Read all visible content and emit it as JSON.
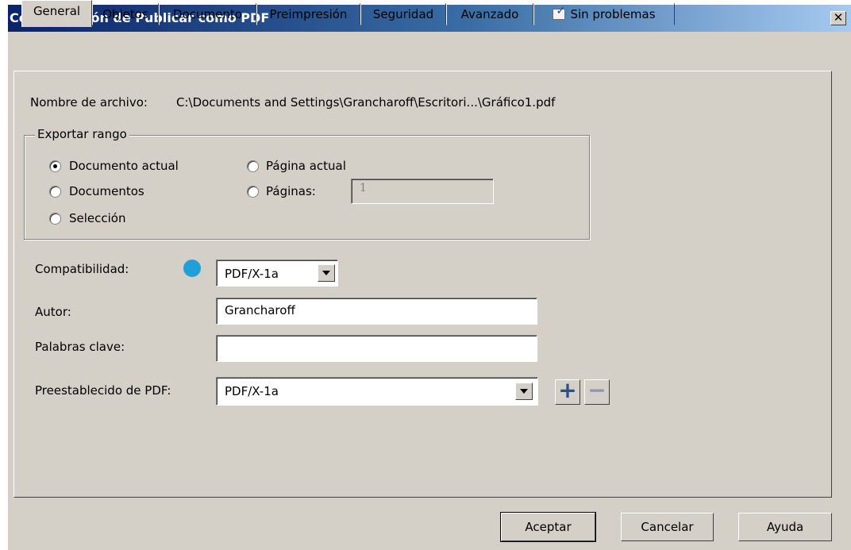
{
  "window": {
    "title": "Configuración de Publicar como PDF",
    "close_glyph": "✕"
  },
  "tabs": [
    {
      "label": "General",
      "active": true
    },
    {
      "label": "Objetos"
    },
    {
      "label": "Documento"
    },
    {
      "label": "Preimpresión"
    },
    {
      "label": "Seguridad"
    },
    {
      "label": "Avanzado"
    },
    {
      "label": "Sin problemas",
      "icon": "checklist-icon"
    }
  ],
  "general": {
    "filename_label": "Nombre de archivo:",
    "filename_value": "C:\\Documents and Settings\\Grancharoff\\Escritori...\\Gráfico1.pdf",
    "export_range": {
      "title": "Exportar rango",
      "current_document": "Documento actual",
      "documents": "Documentos",
      "selection": "Selección",
      "current_page": "Página actual",
      "pages": "Páginas:",
      "pages_value": "1",
      "selected": "current_document"
    },
    "compatibility_label": "Compatibilidad:",
    "compatibility_value": "PDF/X-1a",
    "author_label": "Autor:",
    "author_value": "Grancharoff",
    "keywords_label": "Palabras clave:",
    "keywords_value": "",
    "preset_label": "Preestablecido de PDF:",
    "preset_value": "PDF/X-1a",
    "add_preset_glyph": "+",
    "remove_preset_glyph": "−"
  },
  "buttons": {
    "ok": "Aceptar",
    "cancel": "Cancelar",
    "help": "Ayuda"
  },
  "colors": {
    "accent_dot": "#1fa0d8",
    "title_gradient_start": "#0a246a",
    "dialog_bg": "#d4d0c8"
  }
}
